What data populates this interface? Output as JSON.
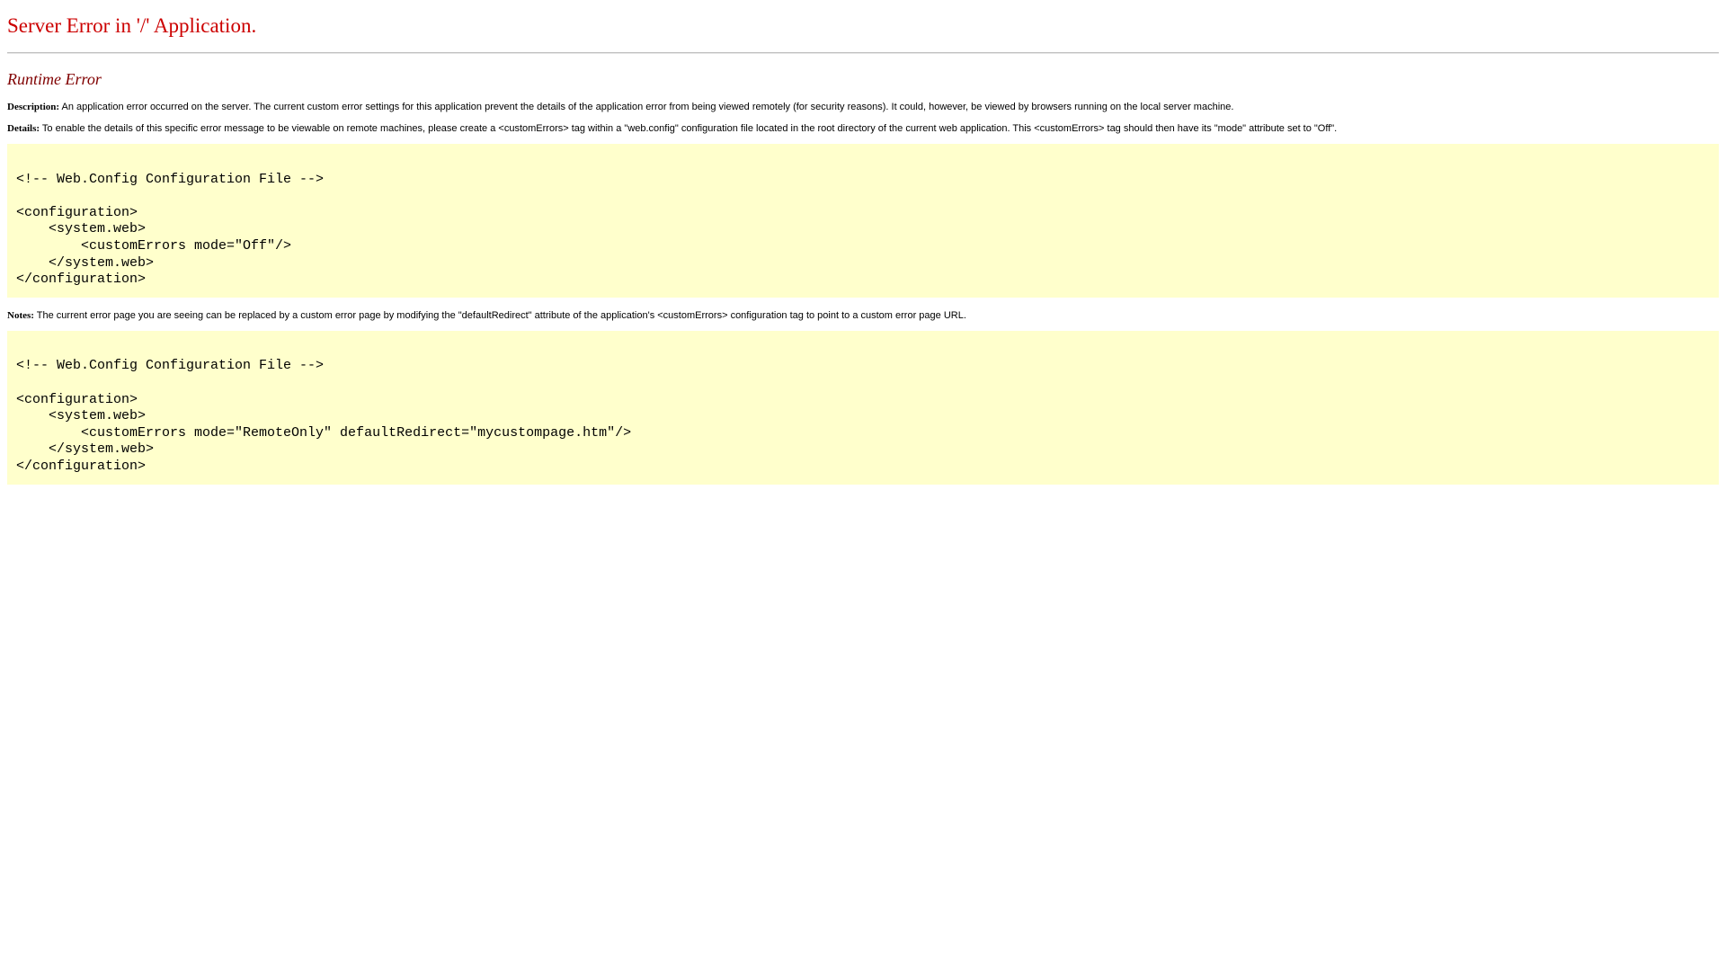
{
  "page": {
    "title": "Server Error in '/' Application.",
    "error_heading": "Runtime Error"
  },
  "description": {
    "label": "Description:",
    "text": "An application error occurred on the server. The current custom error settings for this application prevent the details of the application error from being viewed remotely (for security reasons). It could, however, be viewed by browsers running on the local server machine."
  },
  "details": {
    "label": "Details:",
    "text": "To enable the details of this specific error message to be viewable on remote machines, please create a <customErrors> tag within a \"web.config\" configuration file located in the root directory of the current web application. This <customErrors> tag should then have its \"mode\" attribute set to \"Off\"."
  },
  "code_sample_1": "\n<!-- Web.Config Configuration File -->\n\n<configuration>\n    <system.web>\n        <customErrors mode=\"Off\"/>\n    </system.web>\n</configuration>",
  "notes": {
    "label": "Notes:",
    "text": "The current error page you are seeing can be replaced by a custom error page by modifying the \"defaultRedirect\" attribute of the application's <customErrors> configuration tag to point to a custom error page URL."
  },
  "code_sample_2": "\n<!-- Web.Config Configuration File -->\n\n<configuration>\n    <system.web>\n        <customErrors mode=\"RemoteOnly\" defaultRedirect=\"mycustompage.htm\"/>\n    </system.web>\n</configuration>",
  "colors": {
    "title": "#cc0000",
    "error_heading": "#800000",
    "code_background": "#ffffcc"
  }
}
